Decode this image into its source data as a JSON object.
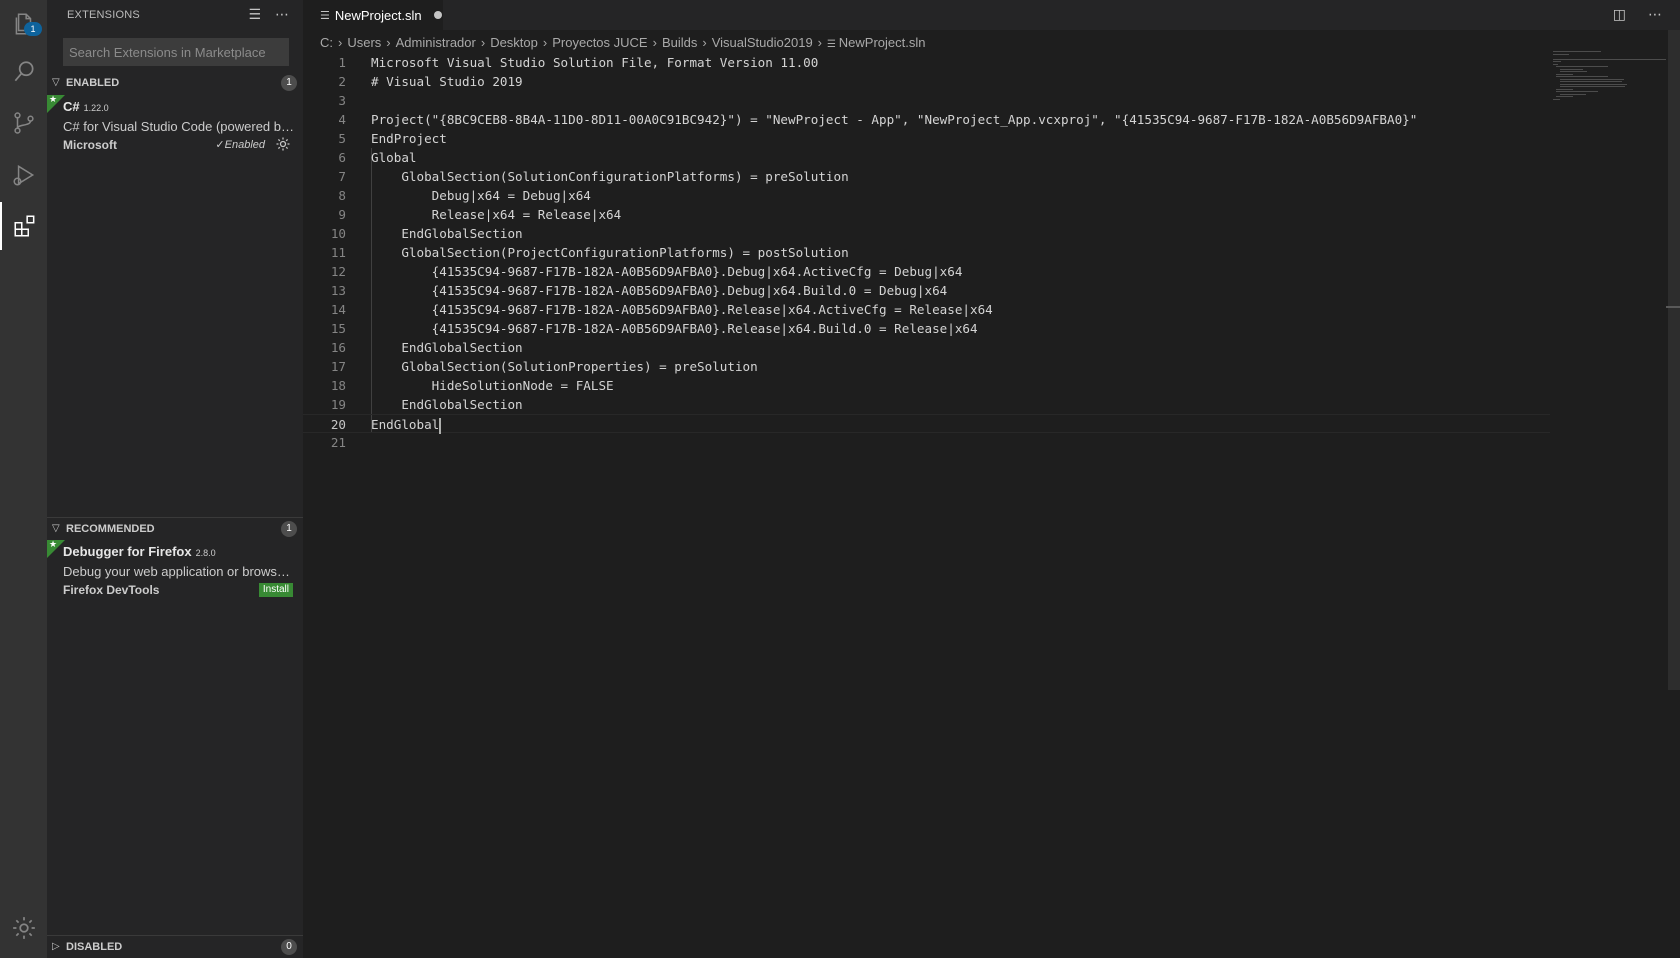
{
  "activity_bar": {
    "explorer_badge": "1",
    "items": [
      "files-icon",
      "search-icon",
      "source-control-icon",
      "run-debug-icon",
      "extensions-icon",
      "settings-gear-icon"
    ]
  },
  "sidebar": {
    "title": "EXTENSIONS",
    "search_placeholder": "Search Extensions in Marketplace",
    "enabled": {
      "label": "ENABLED",
      "count": "1",
      "items": [
        {
          "name": "C#",
          "version": "1.22.0",
          "description": "C# for Visual Studio Code (powered by OmniSharp).",
          "publisher": "Microsoft",
          "status": "✓Enabled"
        }
      ]
    },
    "recommended": {
      "label": "RECOMMENDED",
      "count": "1",
      "items": [
        {
          "name": "Debugger for Firefox",
          "version": "2.8.0",
          "description": "Debug your web application or browser extension in Firefox",
          "publisher": "Firefox DevTools",
          "action": "Install"
        }
      ]
    },
    "disabled": {
      "label": "DISABLED",
      "count": "0"
    }
  },
  "editor": {
    "tab": {
      "filename": "NewProject.sln"
    },
    "breadcrumb": [
      "C:",
      "Users",
      "Administrador",
      "Desktop",
      "Proyectos JUCE",
      "Builds",
      "VisualStudio2019",
      "NewProject.sln"
    ],
    "current_line": 20,
    "lines": [
      "Microsoft Visual Studio Solution File, Format Version 11.00",
      "# Visual Studio 2019",
      "",
      "Project(\"{8BC9CEB8-8B4A-11D0-8D11-00A0C91BC942}\") = \"NewProject - App\", \"NewProject_App.vcxproj\", \"{41535C94-9687-F17B-182A-A0B56D9AFBA0}\"",
      "EndProject",
      "Global",
      "    GlobalSection(SolutionConfigurationPlatforms) = preSolution",
      "        Debug|x64 = Debug|x64",
      "        Release|x64 = Release|x64",
      "    EndGlobalSection",
      "    GlobalSection(ProjectConfigurationPlatforms) = postSolution",
      "        {41535C94-9687-F17B-182A-A0B56D9AFBA0}.Debug|x64.ActiveCfg = Debug|x64",
      "        {41535C94-9687-F17B-182A-A0B56D9AFBA0}.Debug|x64.Build.0 = Debug|x64",
      "        {41535C94-9687-F17B-182A-A0B56D9AFBA0}.Release|x64.ActiveCfg = Release|x64",
      "        {41535C94-9687-F17B-182A-A0B56D9AFBA0}.Release|x64.Build.0 = Release|x64",
      "    EndGlobalSection",
      "    GlobalSection(SolutionProperties) = preSolution",
      "        HideSolutionNode = FALSE",
      "    EndGlobalSection",
      "EndGlobal",
      ""
    ]
  }
}
